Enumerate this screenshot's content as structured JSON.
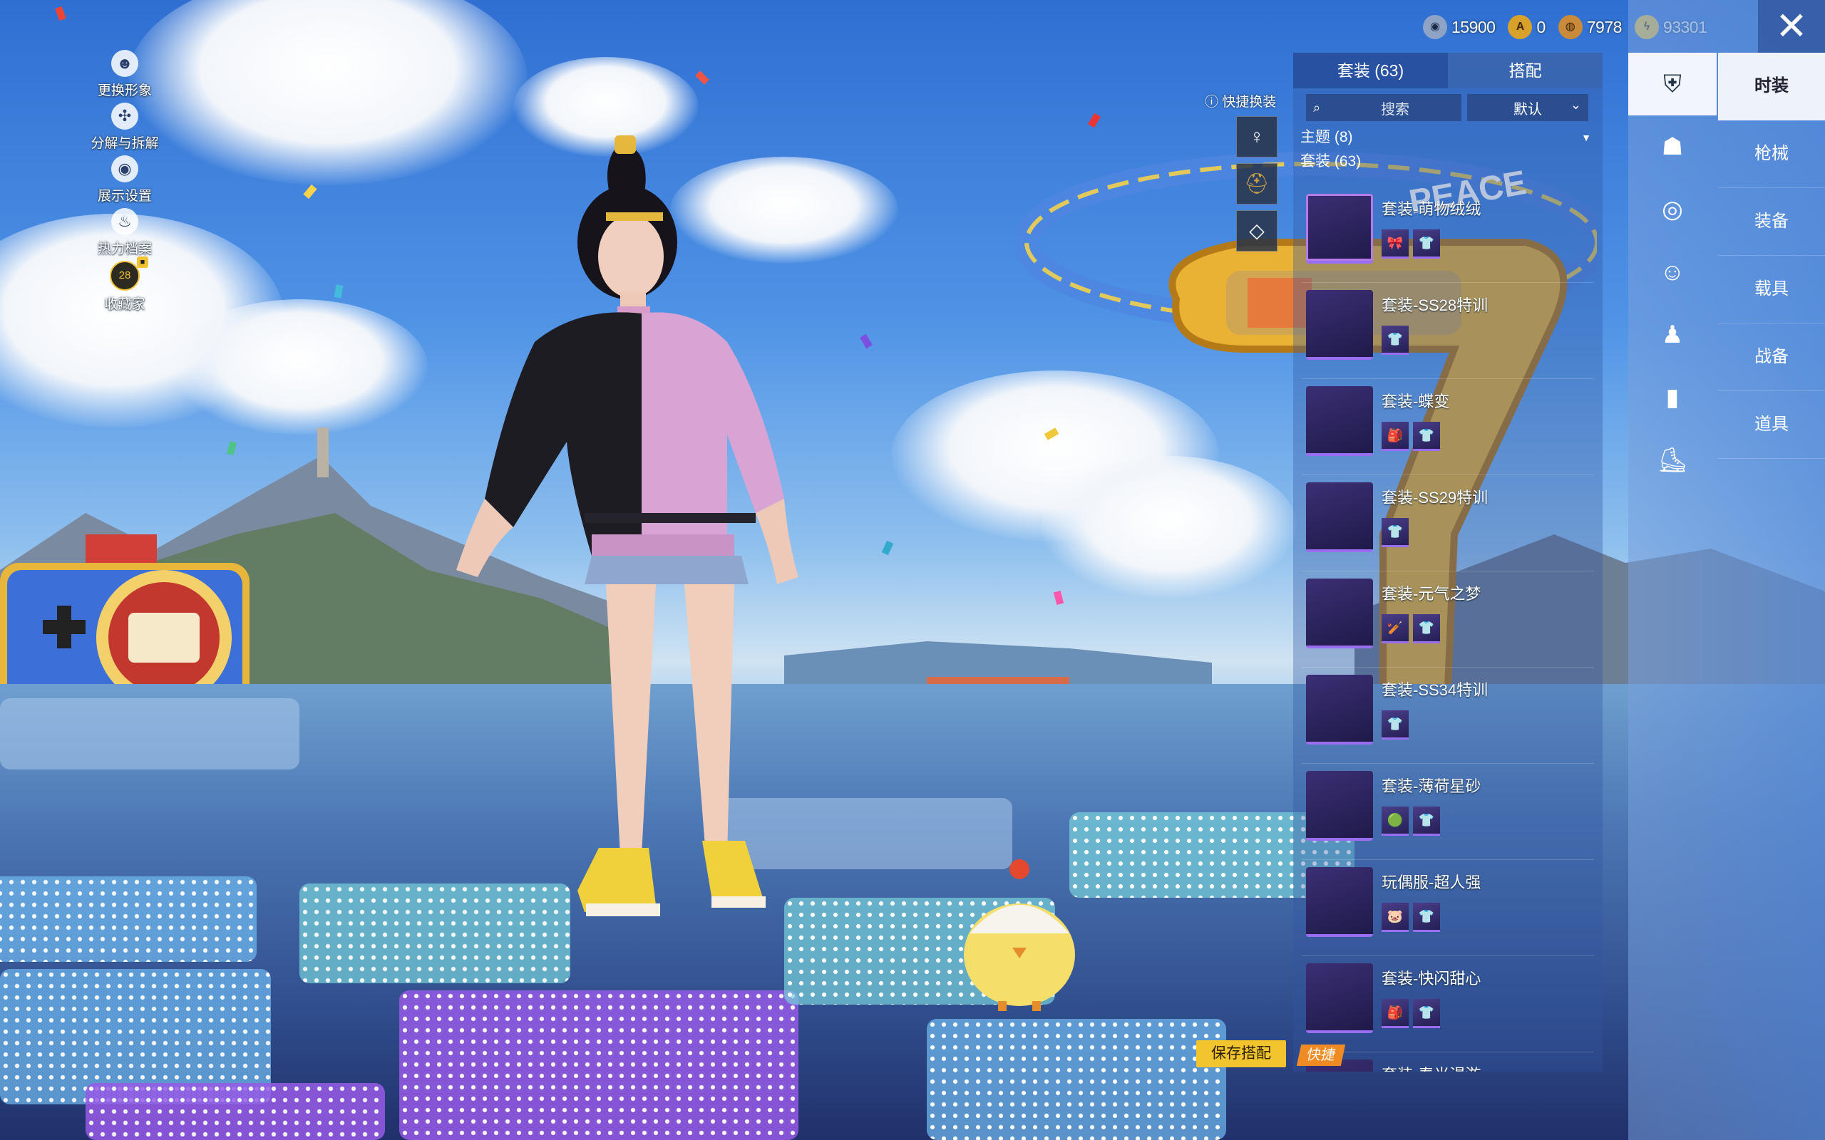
{
  "left_menu": [
    {
      "label": "更换形象",
      "icon": "avatar-icon"
    },
    {
      "label": "分解与拆解",
      "icon": "puzzle-icon"
    },
    {
      "label": "展示设置",
      "icon": "eye-icon"
    },
    {
      "label": "热力档案",
      "icon": "flame-icon"
    },
    {
      "label": "收藏家",
      "icon": "collector-badge-icon",
      "badge": "28"
    }
  ],
  "currencies": [
    {
      "value": "15900",
      "icon": "silver-coin-icon",
      "color": "#8fa3c7"
    },
    {
      "value": "0",
      "icon": "gold-token-icon",
      "color": "#d7a12a"
    },
    {
      "value": "7978",
      "icon": "bronze-coin-icon",
      "color": "#c98b3a"
    },
    {
      "value": "93301",
      "icon": "lightning-coin-icon",
      "color": "#e8c341"
    }
  ],
  "close_label": "✕",
  "tabs": {
    "suits": "套装 (63)",
    "match": "搭配"
  },
  "search": {
    "placeholder": "搜索",
    "sort": "默认"
  },
  "filters": {
    "theme": "主题 (8)",
    "suit": "套装 (63)"
  },
  "quick_change": {
    "title": "快捷换装"
  },
  "outfits": [
    {
      "name": "套装-萌物绒绒",
      "parts": [
        "🎀",
        "👕"
      ]
    },
    {
      "name": "套装-SS28特训",
      "parts": [
        "👕"
      ]
    },
    {
      "name": "套装-蝶变",
      "parts": [
        "🎒",
        "👕"
      ]
    },
    {
      "name": "套装-SS29特训",
      "parts": [
        "👕"
      ]
    },
    {
      "name": "套装-元气之梦",
      "parts": [
        "🏏",
        "👕"
      ]
    },
    {
      "name": "套装-SS34特训",
      "parts": [
        "👕"
      ]
    },
    {
      "name": "套装-薄荷星砂",
      "parts": [
        "🟢",
        "👕"
      ]
    },
    {
      "name": "玩偶服-超人强",
      "parts": [
        "🐷",
        "👕"
      ]
    },
    {
      "name": "套装-快闪甜心",
      "parts": [
        "🎒",
        "👕"
      ]
    },
    {
      "name": "套装-春光漫游",
      "parts": []
    }
  ],
  "categories": [
    {
      "label": "时装",
      "active": true
    },
    {
      "label": "枪械",
      "active": false
    },
    {
      "label": "装备",
      "active": false
    },
    {
      "label": "载具",
      "active": false
    },
    {
      "label": "战备",
      "active": false
    },
    {
      "label": "道具",
      "active": false
    }
  ],
  "save_label": "保存搭配",
  "quick_tag": "快捷"
}
